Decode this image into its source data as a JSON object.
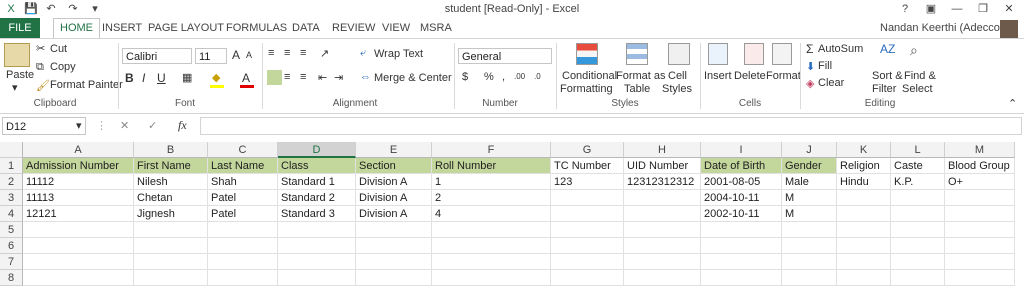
{
  "window": {
    "title": "student  [Read-Only] - Excel",
    "help": "?",
    "minimize": "—",
    "restore": "❐",
    "close": "✕",
    "ribbon_opts": "▣"
  },
  "qat": {
    "save": "💾",
    "undo": "↶",
    "redo": "↷",
    "customize": "▾"
  },
  "tabs": [
    "FILE",
    "HOME",
    "INSERT",
    "PAGE LAYOUT",
    "FORMULAS",
    "DATA",
    "REVIEW",
    "VIEW",
    "MSRA"
  ],
  "user": "Nandan Keerthi (Adecco)",
  "clipboard": {
    "paste": "Paste",
    "cut": "Cut",
    "copy": "Copy",
    "format_painter": "Format Painter",
    "label": "Clipboard"
  },
  "font": {
    "name": "Calibri",
    "size": "11",
    "label": "Font",
    "bold": "B",
    "italic": "I",
    "underline": "U",
    "grow": "A",
    "shrink": "A",
    "color": "A"
  },
  "alignment": {
    "wrap": "Wrap Text",
    "merge": "Merge & Center",
    "label": "Alignment"
  },
  "number": {
    "format": "General",
    "currency": "$",
    "percent": "%",
    "comma": ",",
    "inc": ".00",
    "dec": ".0",
    "label": "Number"
  },
  "styles": {
    "conditional": "Conditional",
    "conditional2": "Formatting",
    "format_as": "Format as",
    "format_as2": "Table",
    "cell": "Cell",
    "cell2": "Styles",
    "label": "Styles"
  },
  "cells": {
    "insert": "Insert",
    "delete": "Delete",
    "format": "Format",
    "label": "Cells"
  },
  "editing": {
    "autosum": "AutoSum",
    "fill": "Fill",
    "clear": "Clear",
    "sort": "Sort &",
    "sort2": "Filter",
    "find": "Find &",
    "find2": "Select",
    "label": "Editing"
  },
  "formula_bar": {
    "name_box": "D12",
    "cancel": "✕",
    "enter": "✓",
    "fx": "fx",
    "content": ""
  },
  "columns": [
    "A",
    "B",
    "C",
    "D",
    "E",
    "F",
    "G",
    "H",
    "I",
    "J",
    "K",
    "L",
    "M"
  ],
  "rows": [
    [
      "Admission Number",
      "First Name",
      "Last Name",
      "Class",
      "Section",
      "Roll Number",
      "TC Number",
      "UID Number",
      "Date of Birth",
      "Gender",
      "Religion",
      "Caste",
      "Blood Group"
    ],
    [
      "11112",
      "Nilesh",
      "Shah",
      "Standard 1",
      "Division A",
      "1",
      "123",
      "12312312312",
      "2001-08-05",
      "Male",
      "Hindu",
      "K.P.",
      "O+"
    ],
    [
      "11113",
      "Chetan",
      "Patel",
      "Standard 2",
      "Division A",
      "2",
      "",
      "",
      "2004-10-11",
      "M",
      "",
      "",
      ""
    ],
    [
      "12121",
      "Jignesh",
      "Patel",
      "Standard 3",
      "Division A",
      "4",
      "",
      "",
      "2002-10-11",
      "M",
      "",
      "",
      ""
    ],
    [
      "",
      "",
      "",
      "",
      "",
      "",
      "",
      "",
      "",
      "",
      "",
      "",
      ""
    ],
    [
      "",
      "",
      "",
      "",
      "",
      "",
      "",
      "",
      "",
      "",
      "",
      "",
      ""
    ],
    [
      "",
      "",
      "",
      "",
      "",
      "",
      "",
      "",
      "",
      "",
      "",
      "",
      ""
    ],
    [
      "",
      "",
      "",
      "",
      "",
      "",
      "",
      "",
      "",
      "",
      "",
      "",
      ""
    ]
  ],
  "row_numbers": [
    "1",
    "2",
    "3",
    "4",
    "5",
    "6",
    "7",
    "8"
  ],
  "colors": {
    "accent": "#217346",
    "header_fill": "#c3d69b"
  }
}
